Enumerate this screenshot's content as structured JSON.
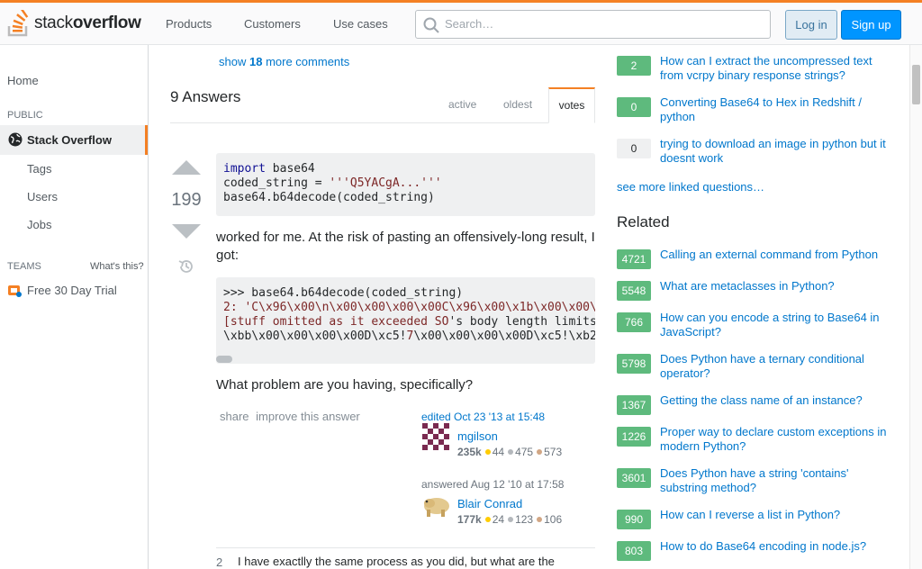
{
  "header": {
    "logo_light": "stack",
    "logo_bold": "overflow",
    "nav": [
      "Products",
      "Customers",
      "Use cases"
    ],
    "search_placeholder": "Search…",
    "login_label": "Log in",
    "signup_label": "Sign up",
    "accent_color": "#f48024"
  },
  "sidebar": {
    "home": "Home",
    "public_label": "PUBLIC",
    "active_item": "Stack Overflow",
    "items": [
      "Tags",
      "Users",
      "Jobs"
    ],
    "teams_label": "TEAMS",
    "whats_this": "What's this?",
    "trial": "Free 30 Day Trial"
  },
  "main": {
    "more_comments_prefix": "show",
    "more_comments_count": "18",
    "more_comments_suffix": "more comments",
    "answers_title": "9 Answers",
    "tabs": [
      "active",
      "oldest",
      "votes"
    ],
    "answer": {
      "votes": "199",
      "code1": {
        "import_kw": "import",
        "import_rest": " base64",
        "line2_a": "coded_string = ",
        "line2_str": "'''Q5YACgA...'''",
        "line3": "base64.b64decode(coded_string)"
      },
      "para1": "worked for me. At the risk of pasting an offensively-long result, I got:",
      "code2": {
        "line1": ">>> base64.b64decode(coded_string)",
        "line2": "2: 'C\\x96\\x00\\n\\x00\\x00\\x00\\x00C\\x96\\x00\\x1b\\x00\\x00\\",
        "line3_str": "[stuff omitted as it exceeded SO",
        "line3_rest": "'s body length limits",
        "line4_a": "\\xbb\\x00\\x00\\x00\\x00D\\xc5!",
        "line4_str": "7",
        "line4_b": "\\x00\\x00\\x00\\x00D\\xc5!\\xb2"
      },
      "para2": "What problem are you having, specifically?",
      "menu": [
        "share",
        "improve this answer"
      ],
      "edited": {
        "action": "edited Oct 23 '13 at 15:48",
        "user": "mgilson",
        "rep": "235k",
        "gold": "44",
        "silver": "475",
        "bronze": "573"
      },
      "answered": {
        "action": "answered Aug 12 '10 at 17:58",
        "user": "Blair Conrad",
        "rep": "177k",
        "gold": "24",
        "silver": "123",
        "bronze": "106"
      },
      "comment": {
        "score": "2",
        "text": "I have exactlly the same process as you did, but what are the"
      }
    }
  },
  "linked": [
    {
      "score": "2",
      "title": "How can I extract the uncompressed text from vcrpy binary response strings?",
      "answered": true
    },
    {
      "score": "0",
      "title": "Converting Base64 to Hex in Redshift / python",
      "answered": true
    },
    {
      "score": "0",
      "title": "trying to download an image in python but it doesnt work",
      "answered": false
    }
  ],
  "see_more": "see more linked questions…",
  "related_title": "Related",
  "related": [
    {
      "score": "4721",
      "title": "Calling an external command from Python"
    },
    {
      "score": "5548",
      "title": "What are metaclasses in Python?"
    },
    {
      "score": "766",
      "title": "How can you encode a string to Base64 in JavaScript?"
    },
    {
      "score": "5798",
      "title": "Does Python have a ternary conditional operator?"
    },
    {
      "score": "1367",
      "title": "Getting the class name of an instance?"
    },
    {
      "score": "1226",
      "title": "Proper way to declare custom exceptions in modern Python?"
    },
    {
      "score": "3601",
      "title": "Does Python have a string 'contains' substring method?"
    },
    {
      "score": "990",
      "title": "How can I reverse a list in Python?"
    },
    {
      "score": "803",
      "title": "How to do Base64 encoding in node.js?"
    }
  ]
}
